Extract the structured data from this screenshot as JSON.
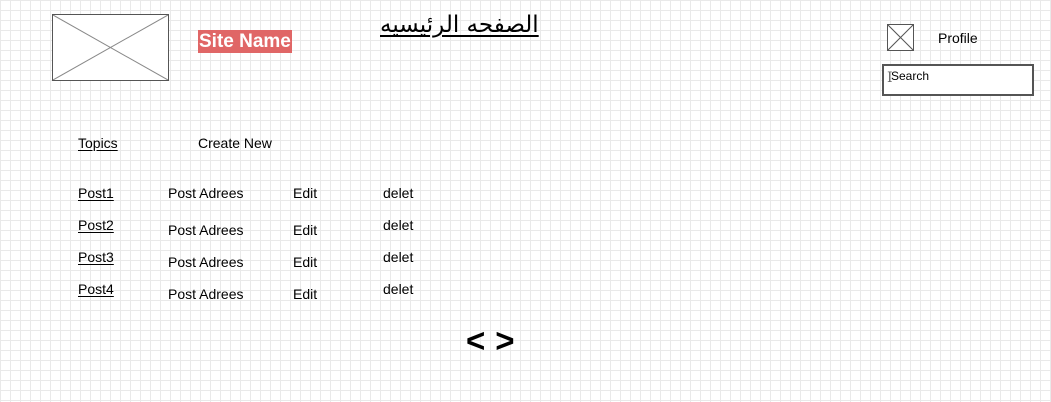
{
  "header": {
    "site_name": "Site Name",
    "page_title": "الصفحه الرئيسيه",
    "profile_label": "Profile",
    "search": {
      "placeholder": "Search"
    }
  },
  "nav": {
    "topics_label": "Topics",
    "create_label": "Create New"
  },
  "posts": [
    {
      "name": "Post1",
      "address": "Post Adrees",
      "edit": "Edit",
      "delete": "delet"
    },
    {
      "name": "Post2",
      "address": "Post Adrees",
      "edit": "Edit",
      "delete": "delet"
    },
    {
      "name": "Post3",
      "address": "Post Adrees",
      "edit": "Edit",
      "delete": "delet"
    },
    {
      "name": "Post4",
      "address": "Post Adrees",
      "edit": "Edit",
      "delete": "delet"
    }
  ],
  "pagination": {
    "prev": "<",
    "next": ">"
  },
  "colors": {
    "site_name_bg": "#e06666",
    "grid": "#e9e9e9"
  }
}
